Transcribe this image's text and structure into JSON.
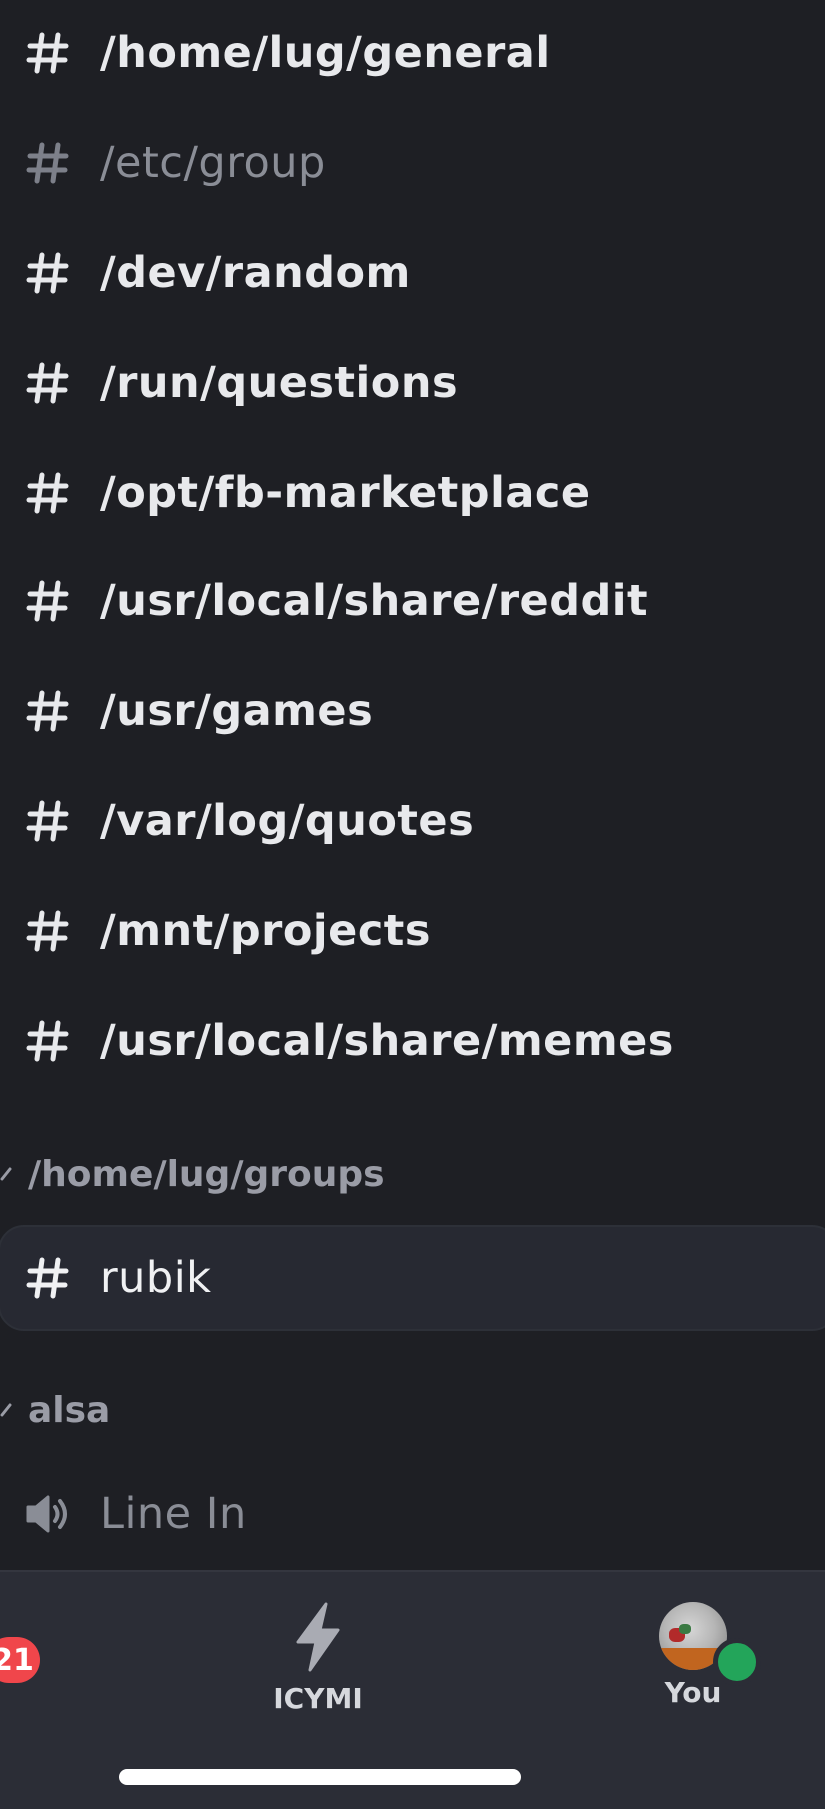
{
  "channels_top": [
    {
      "label": "/home/lug/general",
      "muted": false
    },
    {
      "label": "/etc/group",
      "muted": true
    },
    {
      "label": "/dev/random",
      "muted": false
    },
    {
      "label": "/run/questions",
      "muted": false
    },
    {
      "label": "/opt/fb-marketplace",
      "muted": false
    },
    {
      "label": "/usr/local/share/reddit",
      "muted": false
    },
    {
      "label": "/usr/games",
      "muted": false
    },
    {
      "label": "/var/log/quotes",
      "muted": false
    },
    {
      "label": "/mnt/projects",
      "muted": false
    },
    {
      "label": "/usr/local/share/memes",
      "muted": false
    }
  ],
  "categories": {
    "groups": "/home/lug/groups",
    "alsa": "alsa"
  },
  "group_channel": {
    "label": "rubik",
    "selected": true
  },
  "voice_channel": {
    "label": "Line In",
    "icon": "speaker-icon"
  },
  "bottom_nav": {
    "badge_count": "21",
    "icymi_label": "ICYMI",
    "icymi_icon": "lightning-icon",
    "you_label": "You",
    "status": "online"
  },
  "colors": {
    "background": "#1e1f24",
    "selected": "#272932",
    "nav_background": "#2b2d36",
    "badge": "#f0464b",
    "online": "#23a55a"
  }
}
